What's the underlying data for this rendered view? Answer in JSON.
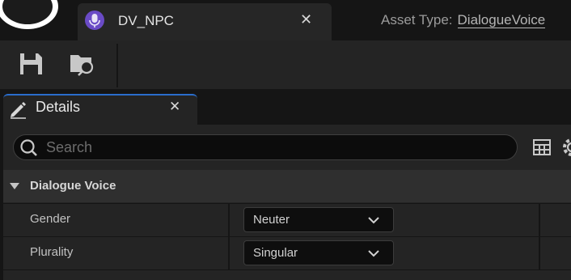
{
  "titlebar": {
    "asset_tab_title": "DV_NPC",
    "asset_tab_close": "✕",
    "asset_type_label": "Asset Type:",
    "asset_type_value": "DialogueVoice"
  },
  "toolbar": {
    "save_icon": "save-icon",
    "browse_icon": "browse-to-asset-icon"
  },
  "details": {
    "tab_title": "Details",
    "tab_close": "✕",
    "search_placeholder": "Search",
    "category": "Dialogue Voice",
    "properties": [
      {
        "label": "Gender",
        "value": "Neuter"
      },
      {
        "label": "Plurality",
        "value": "Singular"
      }
    ]
  },
  "colors": {
    "accent": "#2a6dcc",
    "tab_icon": "#6a4bc6"
  }
}
